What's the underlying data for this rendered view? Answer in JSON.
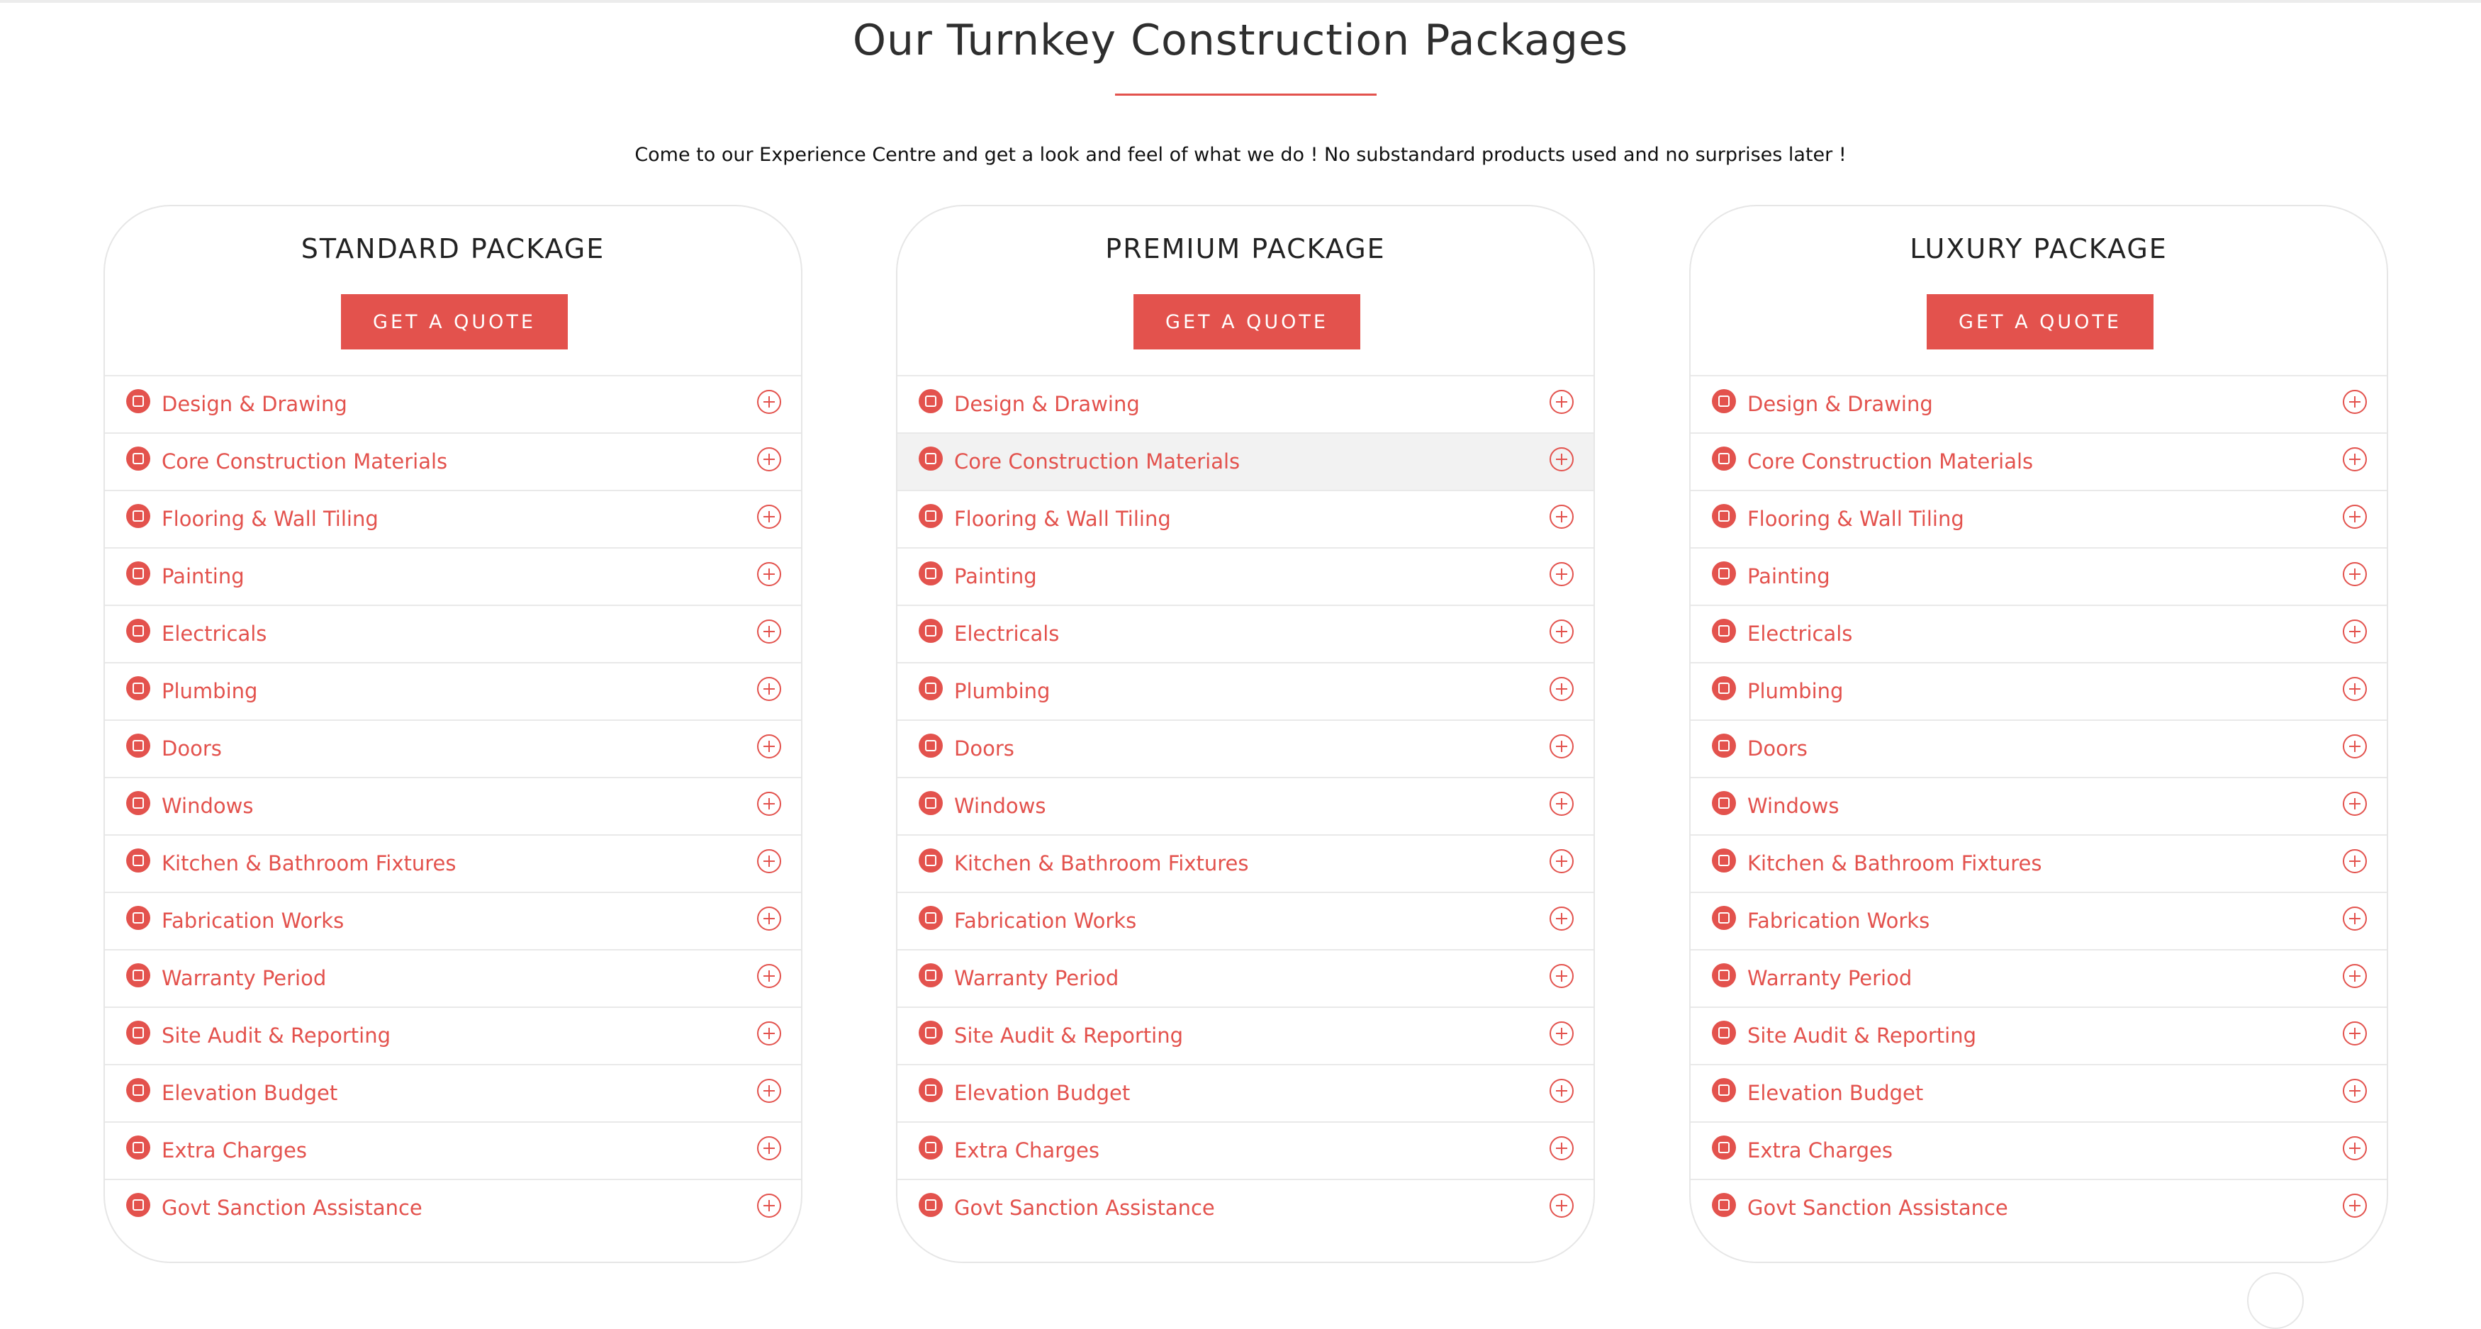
{
  "page": {
    "title": "Our Turnkey Construction Packages",
    "subtitle": "Come to our Experience Centre and get a look and feel of what we do ! No substandard products used and no surprises later !",
    "accent_color": "#e3524d"
  },
  "packages": [
    {
      "name": "STANDARD PACKAGE",
      "button_label": "GET A QUOTE",
      "items": [
        "Design & Drawing",
        "Core Construction Materials",
        "Flooring & Wall Tiling",
        "Painting",
        "Electricals",
        "Plumbing",
        "Doors",
        "Windows",
        "Kitchen & Bathroom Fixtures",
        "Fabrication Works",
        "Warranty Period",
        "Site Audit & Reporting",
        "Elevation Budget",
        "Extra Charges",
        "Govt Sanction Assistance"
      ],
      "icons": {
        "item_icon": "square-bullet-icon",
        "expand_icon": "plus-circle-icon"
      }
    },
    {
      "name": "PREMIUM PACKAGE",
      "button_label": "GET A QUOTE",
      "highlighted_item": "Core Construction Materials",
      "items": [
        "Design & Drawing",
        "Core Construction Materials",
        "Flooring & Wall Tiling",
        "Painting",
        "Electricals",
        "Plumbing",
        "Doors",
        "Windows",
        "Kitchen & Bathroom Fixtures",
        "Fabrication Works",
        "Warranty Period",
        "Site Audit & Reporting",
        "Elevation Budget",
        "Extra Charges",
        "Govt Sanction Assistance"
      ],
      "icons": {
        "item_icon": "square-bullet-icon",
        "expand_icon": "plus-circle-icon"
      }
    },
    {
      "name": "LUXURY PACKAGE",
      "button_label": "GET A QUOTE",
      "items": [
        "Design & Drawing",
        "Core Construction Materials",
        "Flooring & Wall Tiling",
        "Painting",
        "Electricals",
        "Plumbing",
        "Doors",
        "Windows",
        "Kitchen & Bathroom Fixtures",
        "Fabrication Works",
        "Warranty Period",
        "Site Audit & Reporting",
        "Elevation Budget",
        "Extra Charges",
        "Govt Sanction Assistance"
      ],
      "icons": {
        "item_icon": "square-bullet-icon",
        "expand_icon": "plus-circle-icon"
      }
    }
  ]
}
